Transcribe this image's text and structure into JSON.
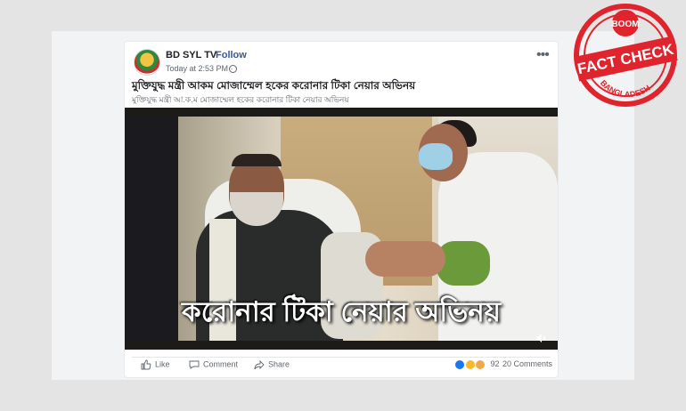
{
  "post": {
    "page_name": "BD SYL TV",
    "separator": "·",
    "follow_label": "Follow",
    "timestamp": "Today at 2:53 PM ·",
    "headline": "মুক্তিযুদ্ধ মন্ত্রী আকম মোজাম্মেল হকের করোনার টিকা নেয়ার অভিনয়",
    "subline": "মুক্তিযুদ্ধ মন্ত্রী আ.ক.ম মোজাম্মেল হকের করোনার টিকা নেয়ার অভিনয়",
    "more_icon": "more-horizontal-icon",
    "globe_icon": "globe-icon"
  },
  "video": {
    "caption": "করোনার টিকা  নেয়ার অভিনয়",
    "mute_icon": "speaker-icon"
  },
  "actions": {
    "like_label": "Like",
    "comment_label": "Comment",
    "share_label": "Share"
  },
  "engagement": {
    "reaction_count": "92",
    "comment_count": "20 Comments",
    "reactions": [
      "like",
      "haha",
      "sad"
    ]
  },
  "stamp": {
    "brand": "BOOM",
    "line1": "FACT CHECK",
    "line2": "BANGLADESH",
    "color": "#e0242d"
  }
}
